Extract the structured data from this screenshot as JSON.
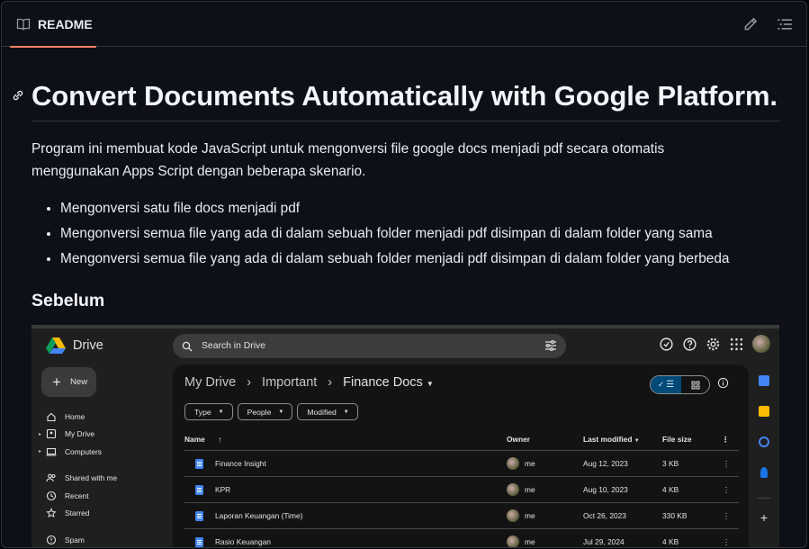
{
  "readme": {
    "tab_label": "README",
    "title": "Convert Documents Automatically with Google Platform.",
    "description": "Program ini membuat kode JavaScript untuk mengonversi file google docs menjadi pdf secara otomatis menggunakan Apps Script dengan beberapa skenario.",
    "bullets": [
      "Mengonversi satu file docs menjadi pdf",
      "Mengonversi semua file yang ada di dalam sebuah folder menjadi pdf disimpan di dalam folder yang sama",
      "Mengonversi semua file yang ada di dalam sebuah folder menjadi pdf disimpan di dalam folder yang berbeda"
    ],
    "section_heading": "Sebelum"
  },
  "drive": {
    "logo_text": "Drive",
    "search_placeholder": "Search in Drive",
    "new_label": "New",
    "nav": [
      "Home",
      "My Drive",
      "Computers",
      "Shared with me",
      "Recent",
      "Starred",
      "Spam"
    ],
    "breadcrumb": [
      "My Drive",
      "Important",
      "Finance Docs"
    ],
    "filters": [
      "Type",
      "People",
      "Modified"
    ],
    "columns": {
      "name": "Name",
      "owner": "Owner",
      "modified": "Last modified",
      "size": "File size"
    },
    "files": [
      {
        "name": "Finance Insight",
        "owner": "me",
        "modified": "Aug 12, 2023",
        "size": "3 KB"
      },
      {
        "name": "KPR",
        "owner": "me",
        "modified": "Aug 10, 2023",
        "size": "4 KB"
      },
      {
        "name": "Laporan Keuangan (Time)",
        "owner": "me",
        "modified": "Oct 26, 2023",
        "size": "330 KB"
      },
      {
        "name": "Rasio Keuangan",
        "owner": "me",
        "modified": "Jul 29, 2024",
        "size": "4 KB"
      }
    ]
  },
  "colors": {
    "tab_underline": "#f78166",
    "bg": "#0d1117",
    "drive_bg": "#1f1f1f",
    "doc_blue": "#4285f4"
  }
}
